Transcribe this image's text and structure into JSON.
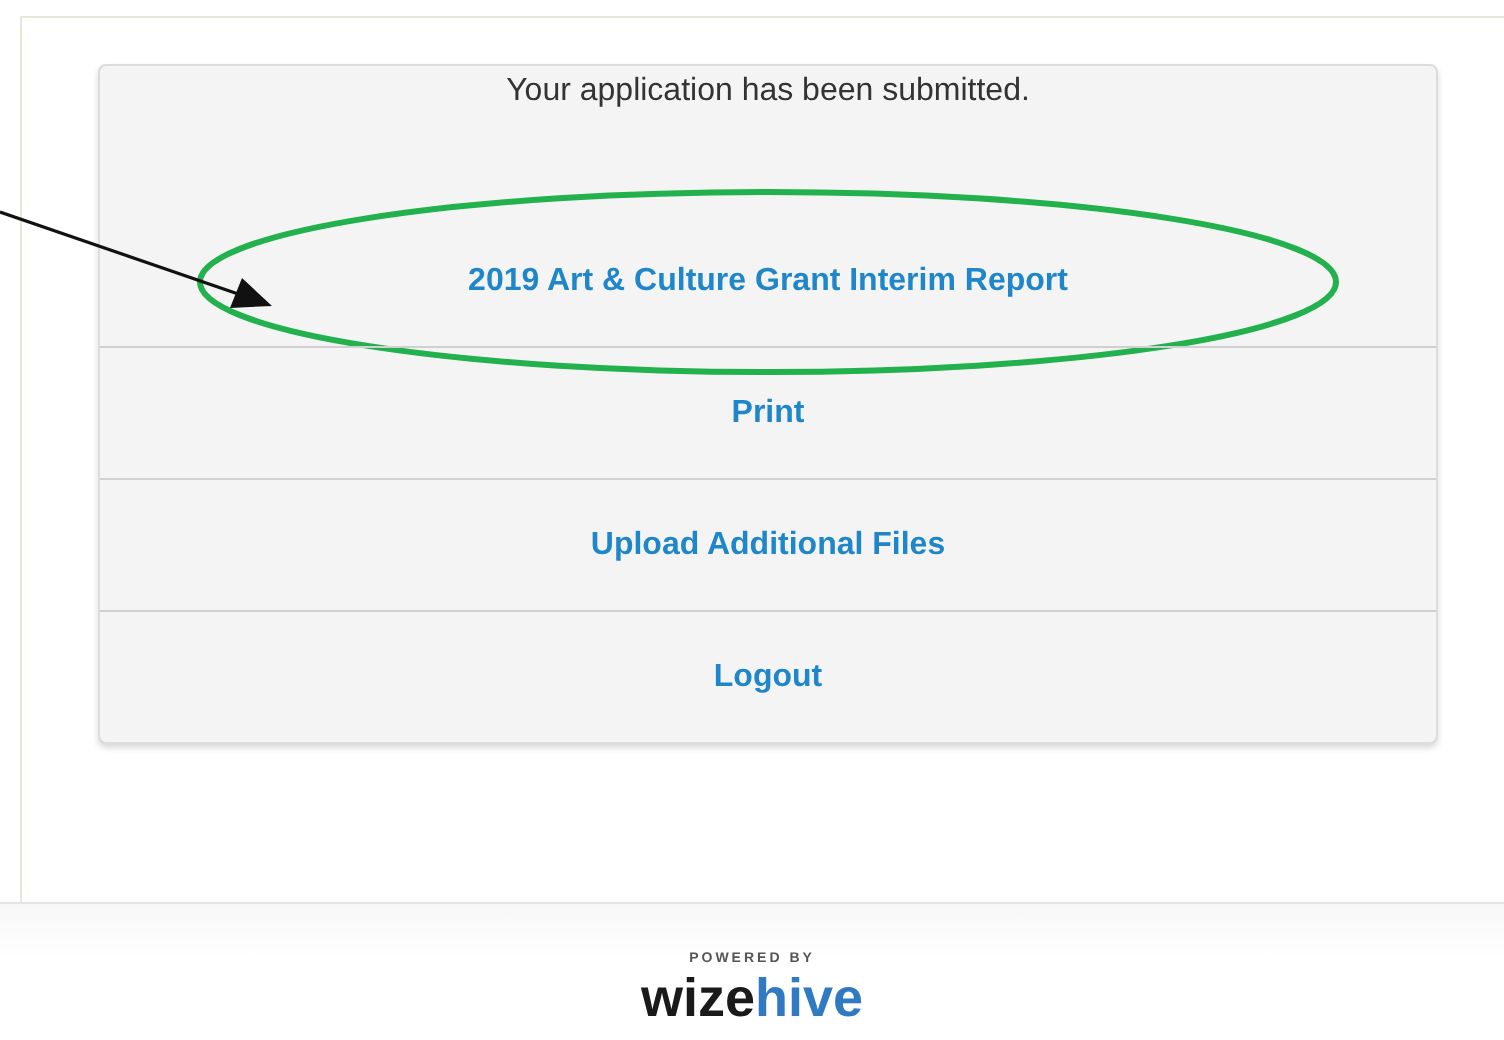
{
  "card": {
    "message": "Your application has been submitted.",
    "links": [
      {
        "label": "2019 Art & Culture Grant Interim Report",
        "circled": true
      },
      {
        "label": "Print",
        "circled": false
      },
      {
        "label": "Upload Additional Files",
        "circled": false
      },
      {
        "label": "Logout",
        "circled": false
      }
    ]
  },
  "footer": {
    "powered_by": "POWERED BY",
    "logo_dark": "wize",
    "logo_accent": "hive"
  }
}
